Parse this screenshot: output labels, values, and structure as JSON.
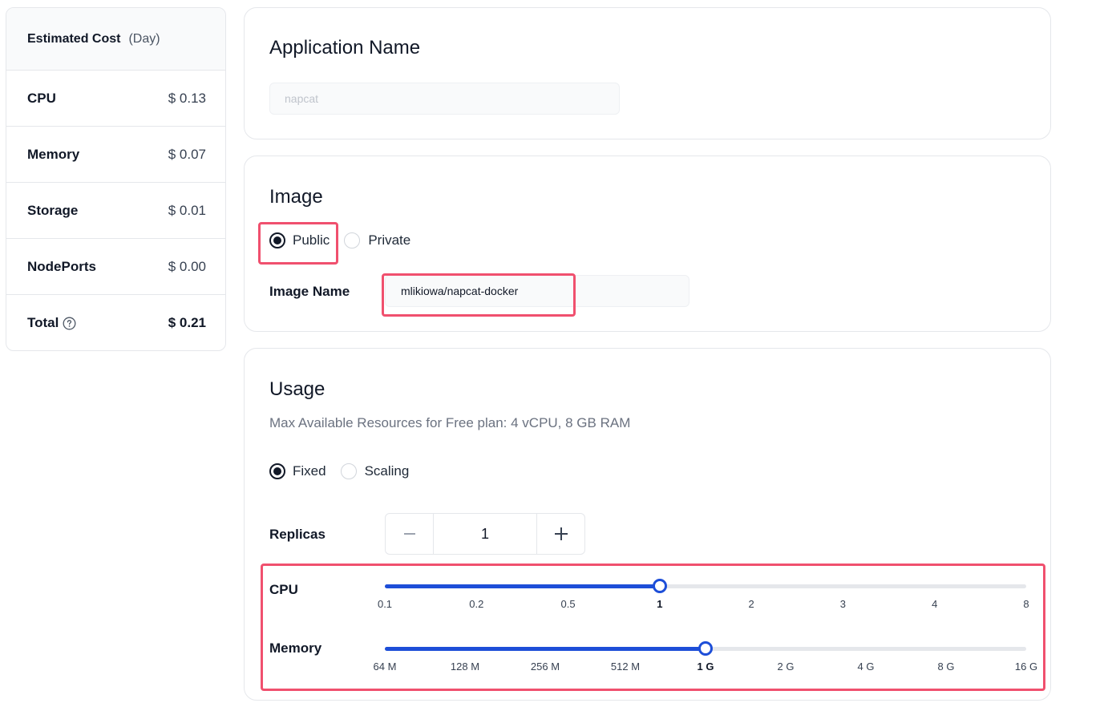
{
  "cost": {
    "title": "Estimated Cost",
    "period": "(Day)",
    "rows": [
      {
        "label": "CPU",
        "value": "$ 0.13"
      },
      {
        "label": "Memory",
        "value": "$ 0.07"
      },
      {
        "label": "Storage",
        "value": "$ 0.01"
      },
      {
        "label": "NodePorts",
        "value": "$ 0.00"
      }
    ],
    "total": {
      "label": "Total",
      "value": "$ 0.21"
    }
  },
  "app": {
    "title": "Application Name",
    "placeholder": "napcat"
  },
  "image": {
    "title": "Image",
    "options": [
      "Public",
      "Private"
    ],
    "selected": "Public",
    "name_label": "Image Name",
    "name_value": "mlikiowa/napcat-docker"
  },
  "usage": {
    "title": "Usage",
    "subtitle": "Max Available Resources for Free plan: 4 vCPU, 8 GB RAM",
    "modes": [
      "Fixed",
      "Scaling"
    ],
    "selected_mode": "Fixed",
    "replicas_label": "Replicas",
    "replicas_value": "1",
    "cpu": {
      "label": "CPU",
      "ticks": [
        "0.1",
        "0.2",
        "0.5",
        "1",
        "2",
        "3",
        "4",
        "8"
      ],
      "selected": "1"
    },
    "memory": {
      "label": "Memory",
      "ticks": [
        "64 M",
        "128 M",
        "256 M",
        "512 M",
        "1 G",
        "2 G",
        "4 G",
        "8 G",
        "16 G"
      ],
      "selected": "1 G"
    }
  },
  "colors": {
    "accent": "#1d4ed8",
    "highlight": "#f0506e"
  }
}
